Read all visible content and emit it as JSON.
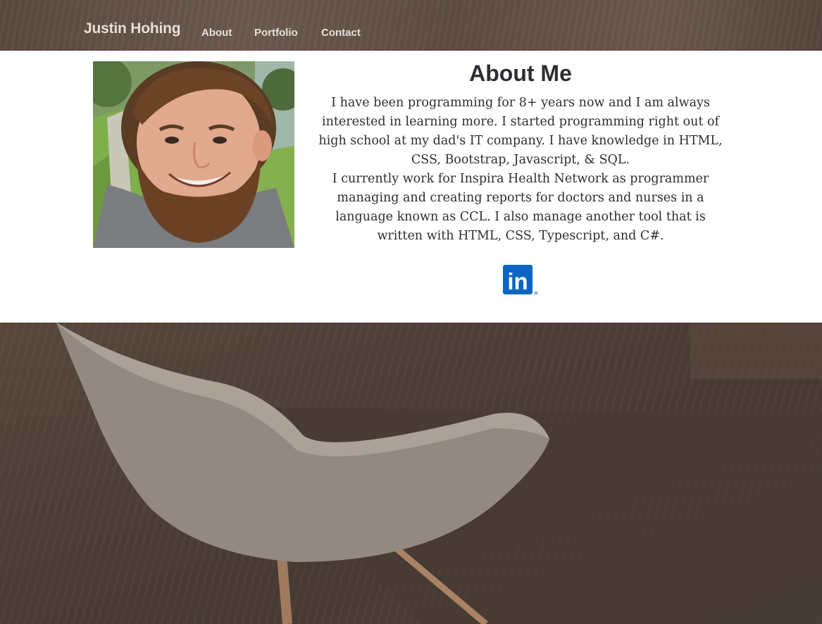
{
  "nav": {
    "brand": "Justin Hohing",
    "links": [
      {
        "label": "About"
      },
      {
        "label": "Portfolio"
      },
      {
        "label": "Contact"
      }
    ]
  },
  "about": {
    "title": "About Me",
    "paragraphs": [
      "I have been programming for 8+ years now and I am always interested in learning more. I started programming right out of high school at my dad's IT company. I have knowledge in HTML, CSS, Bootstrap, Javascript, & SQL.",
      "I currently work for Inspira Health Network as programmer managing and creating reports for doctors and nurses in a language known as CCL. I also manage another tool that is written with HTML, CSS, Typescript, and C#."
    ],
    "photo_alt": "Justin Hohing profile photo",
    "linkedin_icon": "linkedin-icon",
    "linkedin_text": "in"
  },
  "colors": {
    "nav_text": "#e4dfdb",
    "body_text": "#2c2e31",
    "linkedin_blue": "#0a66c2",
    "background_brown": "#4e4039"
  }
}
